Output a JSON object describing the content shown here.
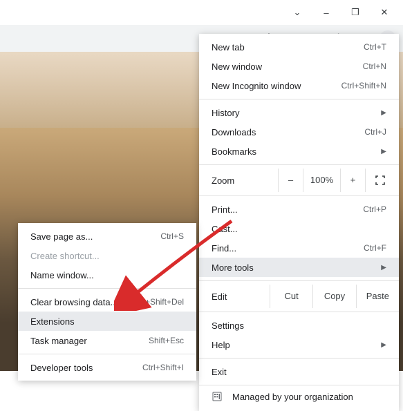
{
  "titlebar": {
    "minimize": "–",
    "restore": "❐",
    "close": "✕",
    "dropdown": "⌄"
  },
  "toolbar": {
    "share": "share-icon",
    "star": "star-icon",
    "shield": "shield-icon",
    "cloud": "cloud-icon",
    "puzzle": "puzzle-icon",
    "brave": "brave-icon",
    "more": "more-icon"
  },
  "menu": {
    "new_tab": {
      "label": "New tab",
      "sc": "Ctrl+T"
    },
    "new_window": {
      "label": "New window",
      "sc": "Ctrl+N"
    },
    "incognito": {
      "label": "New Incognito window",
      "sc": "Ctrl+Shift+N"
    },
    "history": {
      "label": "History"
    },
    "downloads": {
      "label": "Downloads",
      "sc": "Ctrl+J"
    },
    "bookmarks": {
      "label": "Bookmarks"
    },
    "zoom": {
      "label": "Zoom",
      "minus": "–",
      "pct": "100%",
      "plus": "+"
    },
    "print_": {
      "label": "Print...",
      "sc": "Ctrl+P"
    },
    "cast": {
      "label": "Cast..."
    },
    "find": {
      "label": "Find...",
      "sc": "Ctrl+F"
    },
    "more_tools": {
      "label": "More tools"
    },
    "edit": {
      "label": "Edit",
      "cut": "Cut",
      "copy": "Copy",
      "paste": "Paste"
    },
    "settings": {
      "label": "Settings"
    },
    "help": {
      "label": "Help"
    },
    "exit": {
      "label": "Exit"
    },
    "managed": {
      "label": "Managed by your organization"
    }
  },
  "submenu": {
    "save_page": {
      "label": "Save page as...",
      "sc": "Ctrl+S"
    },
    "create_shortcut": {
      "label": "Create shortcut..."
    },
    "name_window": {
      "label": "Name window..."
    },
    "clear_data": {
      "label": "Clear browsing data...",
      "sc": "Ctrl+Shift+Del"
    },
    "extensions": {
      "label": "Extensions"
    },
    "task_manager": {
      "label": "Task manager",
      "sc": "Shift+Esc"
    },
    "dev_tools": {
      "label": "Developer tools",
      "sc": "Ctrl+Shift+I"
    }
  }
}
